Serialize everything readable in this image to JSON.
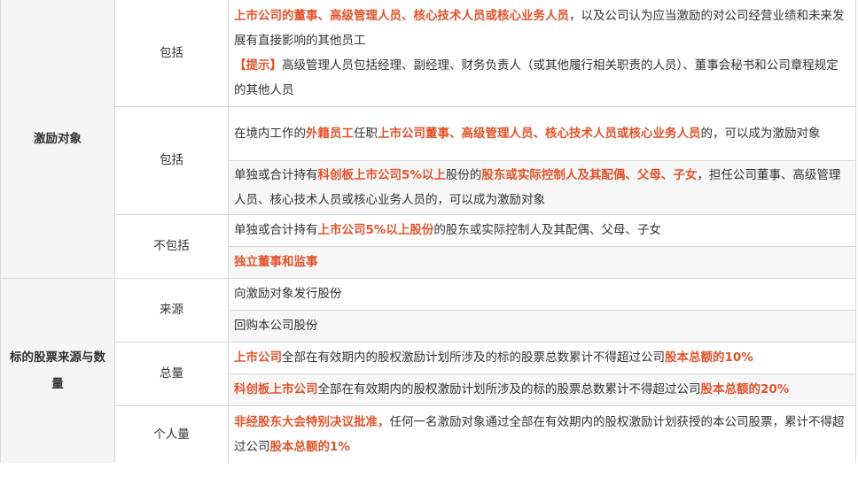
{
  "sections": {
    "incentive_objects": {
      "category": "激励对象",
      "include1": {
        "label": "包括",
        "p1": {
          "highlight1": "上市公司的董事、高级管理人员、核心技术人员或核心业务人员",
          "text1": "，以及公司认为应当激励的对公司经营业绩和未来发展有直接影响的其他员工"
        },
        "p2": {
          "highlight1": "【提示】",
          "text1": "高级管理人员包括经理、副经理、财务负责人（或其他履行相关职责的人员）、董事会秘书和公司章程规定的其他人员"
        }
      },
      "include2": {
        "label": "包括",
        "row1": {
          "text1": "在境内工作的",
          "highlight1": "外籍员工",
          "text2": "任职",
          "highlight2": "上市公司董事、高级管理人员、核心技术人员或核心业务人员",
          "text3": "的，可以成为激励对象"
        },
        "row2": {
          "text1": "单独或合计持有",
          "highlight1": "科创板上市公司5%以上",
          "text2": "股份的",
          "highlight2": "股东或实际控制人及其配偶、父母、子女",
          "text3": "，担任公司董事、高级管理人员、核心技术人员或核心业务人员的，可以成为激励对象"
        }
      },
      "exclude": {
        "label": "不包括",
        "row1": {
          "text1": "单独或合计持有",
          "highlight1": "上市公司5%以上股份",
          "text2": "的股东或实际控制人及其配偶、父母、子女"
        },
        "row2": {
          "highlight1": "独立董事和监事"
        }
      }
    },
    "stock_source_quantity": {
      "category": "标的股票来源与数量",
      "source": {
        "label": "来源",
        "row1": {
          "text1": "向激励对象发行股份"
        },
        "row2": {
          "text1": "回购本公司股份"
        }
      },
      "total": {
        "label": "总量",
        "row1": {
          "highlight1": "上市公司",
          "text1": "全部在有效期内的股权激励计划所涉及的标的股票总数累计不得超过公司",
          "highlight2": "股本总额的10%"
        },
        "row2": {
          "highlight1": "科创板上市公司",
          "text1": "全部在有效期内的股权激励计划所涉及的标的股票总数累计不得超过公司",
          "highlight2": "股本总额的20%"
        }
      },
      "individual": {
        "label": "个人量",
        "row1": {
          "highlight1": "非经股东大会特别决议批准，",
          "text1": "任何一名激励对象通过全部在有效期内的股权激励计划获授的本公司股票，累计不得超过公司",
          "highlight2": "股本总额的1%"
        }
      }
    }
  },
  "colors": {
    "highlight": "#e2532b",
    "category_bg": "#f5f5f5",
    "border": "#d9d9d9"
  }
}
